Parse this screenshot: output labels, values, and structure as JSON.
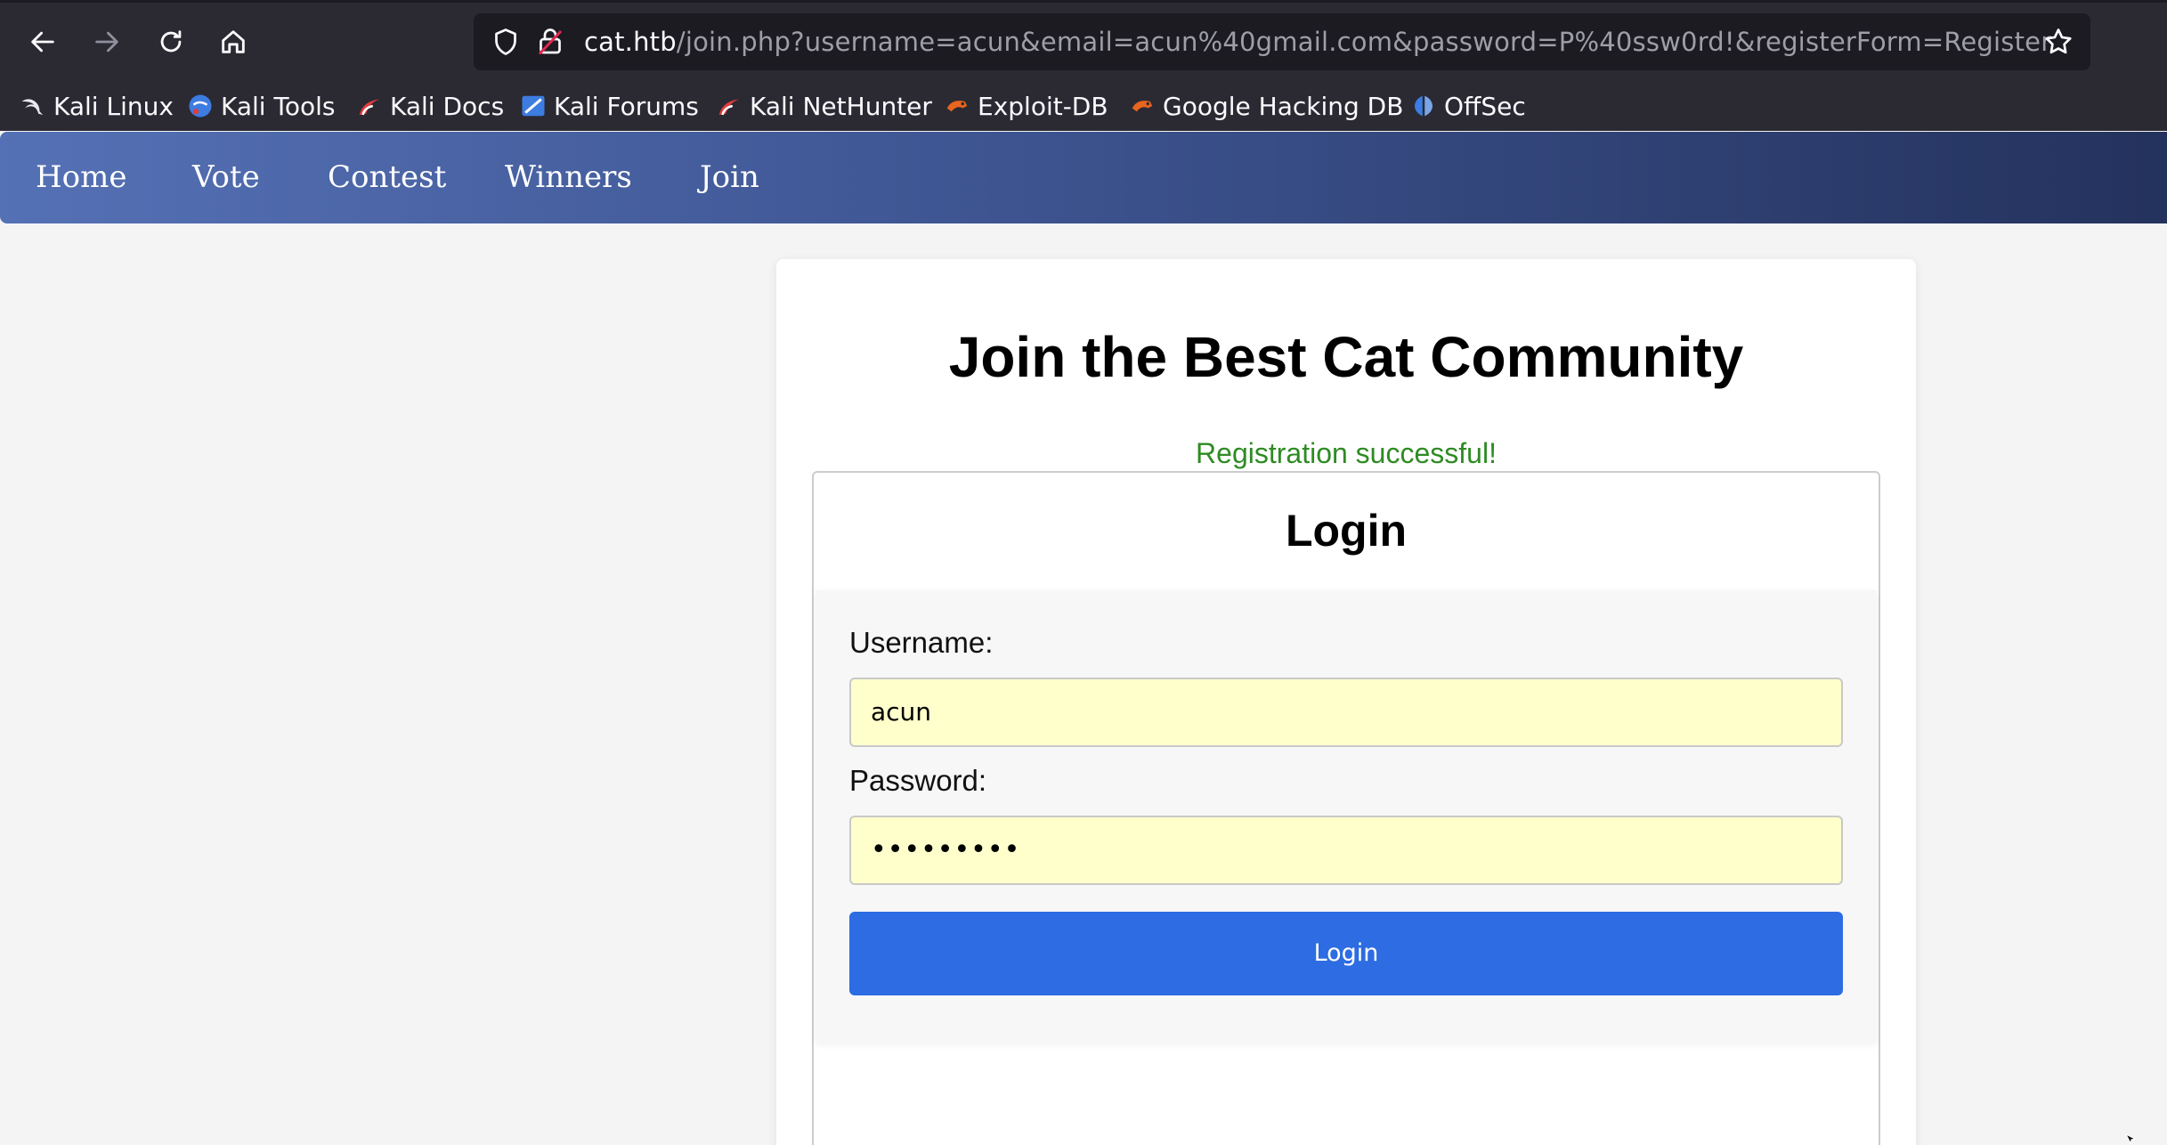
{
  "browser": {
    "url_host": "cat.htb",
    "url_path": "/join.php?username=acun&email=acun%40gmail.com&password=P%40ssw0rd!&registerForm=Register",
    "bookmarks": [
      {
        "label": "Kali Linux",
        "icon": "kali-dragon-icon"
      },
      {
        "label": "Kali Tools",
        "icon": "kali-tools-icon"
      },
      {
        "label": "Kali Docs",
        "icon": "kali-docs-icon"
      },
      {
        "label": "Kali Forums",
        "icon": "kali-forums-icon"
      },
      {
        "label": "Kali NetHunter",
        "icon": "kali-nethunter-icon"
      },
      {
        "label": "Exploit-DB",
        "icon": "exploit-db-icon"
      },
      {
        "label": "Google Hacking DB",
        "icon": "ghdb-icon"
      },
      {
        "label": "OffSec",
        "icon": "offsec-icon"
      }
    ]
  },
  "sitenav": {
    "items": [
      "Home",
      "Vote",
      "Contest",
      "Winners",
      "Join"
    ]
  },
  "page": {
    "title": "Join the Best Cat Community",
    "status_message": "Registration successful!",
    "status_color": "#2e8b23"
  },
  "login": {
    "heading": "Login",
    "username_label": "Username:",
    "username_value": "acun",
    "password_label": "Password:",
    "password_value": "•••••••••",
    "submit_label": "Login",
    "button_color": "#2d6ce2",
    "field_bg": "#ffffcc"
  }
}
